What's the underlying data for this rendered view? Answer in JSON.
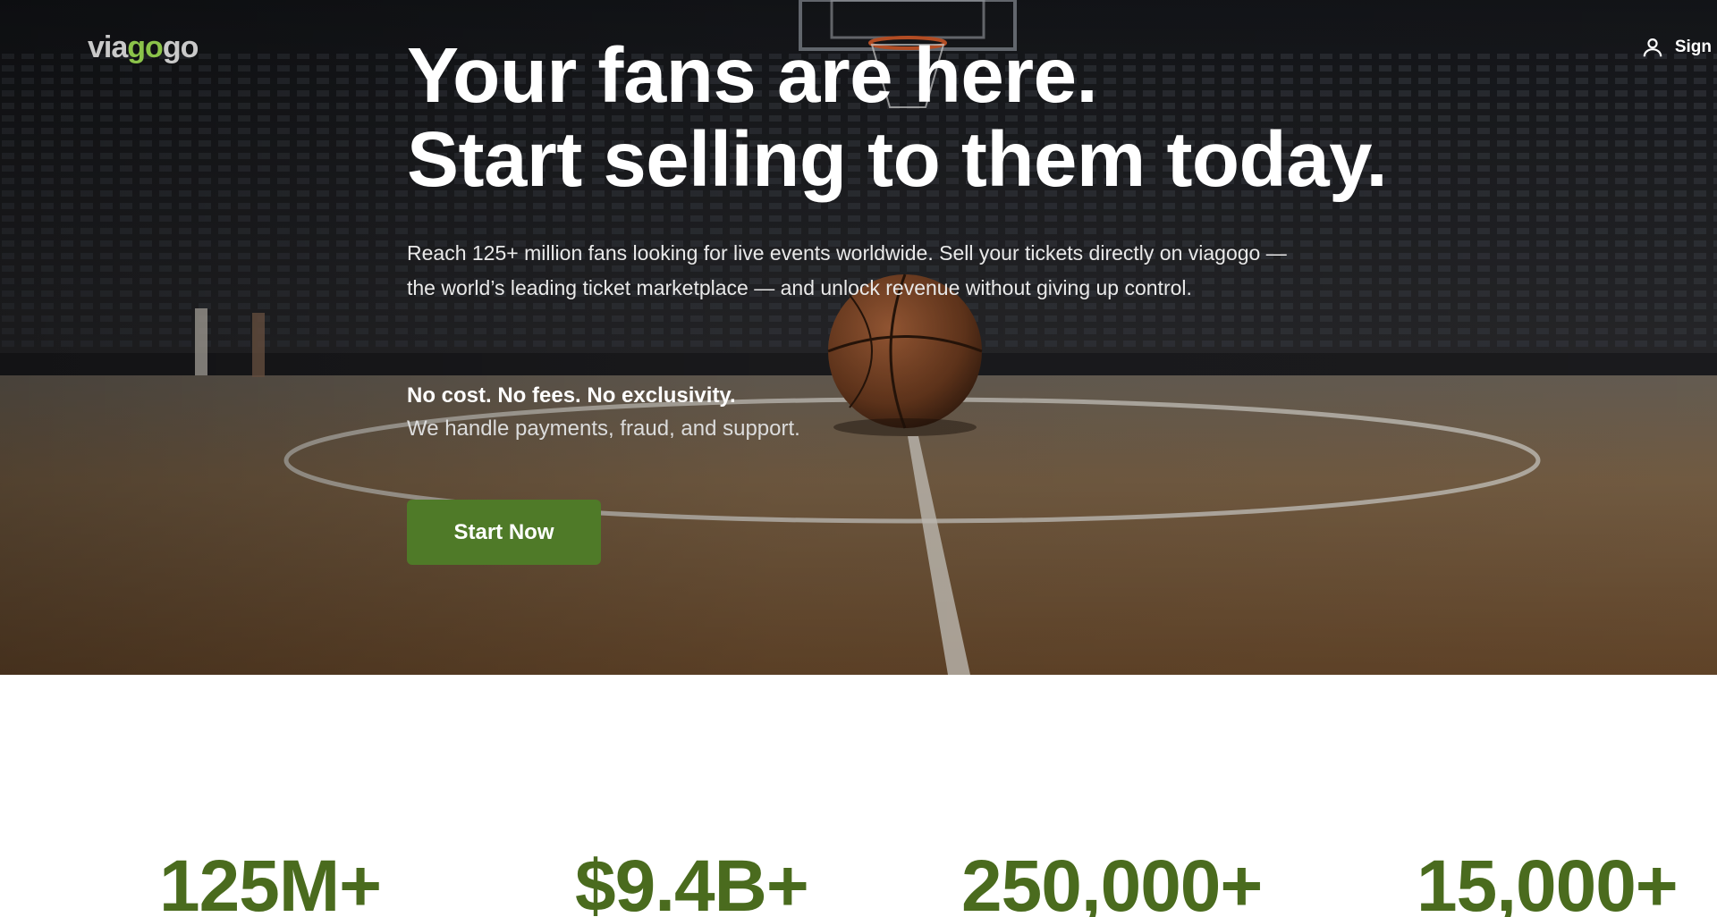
{
  "header": {
    "logo": {
      "part1": "via",
      "part2": "go",
      "part3": "go"
    },
    "signin_label": "Sign",
    "signin_icon": "user-icon"
  },
  "hero": {
    "title_line1": "Your fans are here.",
    "title_line2": "Start selling to them today.",
    "description": "Reach 125+ million fans looking for live events worldwide. Sell your tickets directly on viagogo — the world’s leading ticket marketplace — and unlock revenue without giving up control.",
    "bold_line": "No cost. No fees. No exclusivity.",
    "sub_line": "We handle payments, fraud, and support.",
    "cta_label": "Start Now"
  },
  "stats": [
    {
      "value": "125M+"
    },
    {
      "value": "$9.4B+"
    },
    {
      "value": "250,000+"
    },
    {
      "value": "15,000+"
    }
  ],
  "colors": {
    "brand_green": "#8bc34a",
    "cta_green": "#4f7a28",
    "stat_green": "#4a6b1e"
  }
}
